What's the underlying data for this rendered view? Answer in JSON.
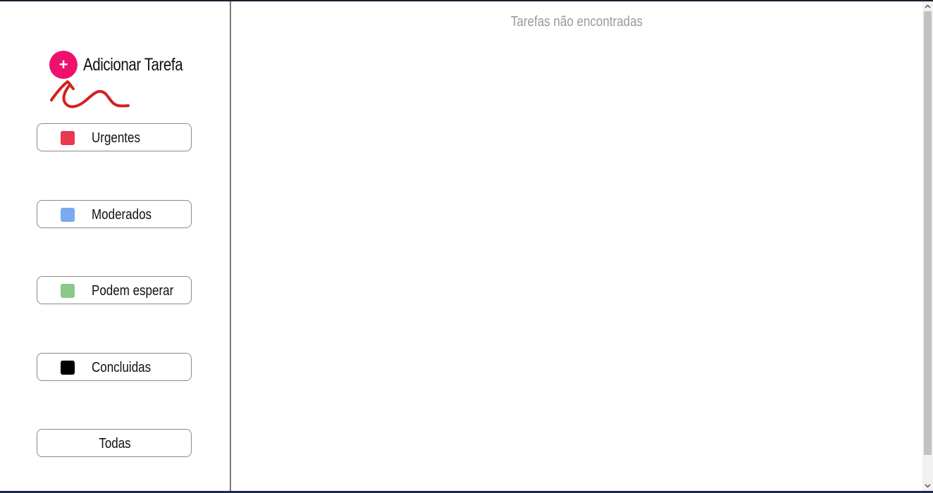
{
  "sidebar": {
    "add_task": {
      "icon_glyph": "+",
      "label": "Adicionar Tarefa",
      "accent_color": "#ee0f6f"
    },
    "filters": [
      {
        "label": "Urgentes",
        "color": "#e8394f"
      },
      {
        "label": "Moderados",
        "color": "#7aaaf0"
      },
      {
        "label": "Podem esperar",
        "color": "#8ac98a"
      },
      {
        "label": "Concluidas",
        "color": "#000000"
      },
      {
        "label": "Todas"
      }
    ]
  },
  "main": {
    "empty_message": "Tarefas não encontradas"
  },
  "annotation": {
    "color": "#d42020"
  }
}
